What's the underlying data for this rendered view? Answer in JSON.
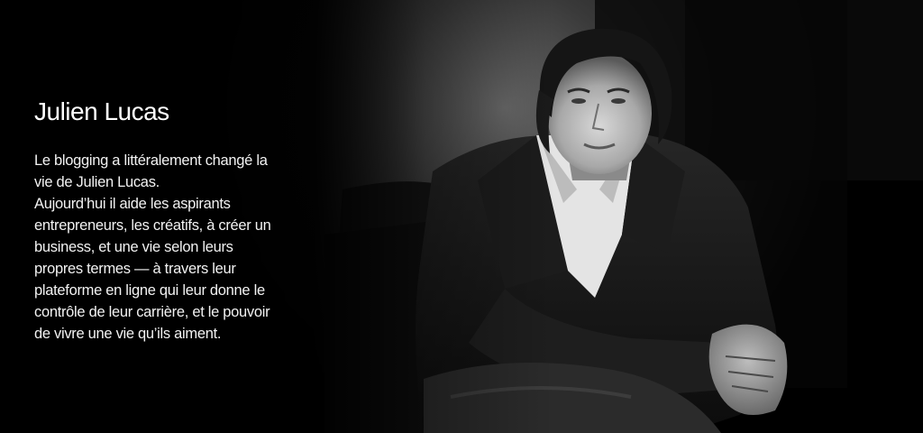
{
  "hero": {
    "title": "Julien Lucas",
    "bio_lines": [
      "Le blogging a littéralement changé la",
      "vie de Julien Lucas.",
      "Aujourd’hui il aide les aspirants",
      "entrepreneurs, les créatifs, à créer un",
      "business, et une vie selon leurs",
      "propres termes — à travers leur",
      "plateforme en ligne qui leur donne le",
      "contrôle de leur carrière, et le pouvoir",
      "de vivre une vie qu’ils aiment."
    ]
  }
}
